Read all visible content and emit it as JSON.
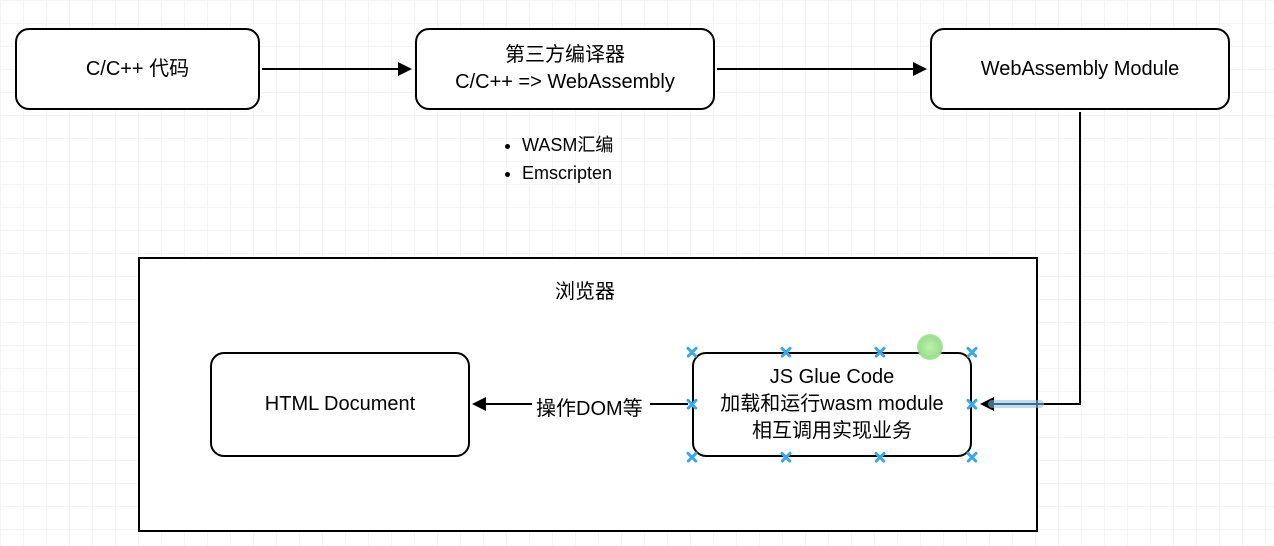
{
  "nodes": {
    "source": {
      "label": "C/C++ 代码"
    },
    "compiler": {
      "line1": "第三方编译器",
      "line2": "C/C++ => WebAssembly"
    },
    "wasm_module": {
      "label": "WebAssembly Module"
    },
    "html_doc": {
      "label": "HTML Document"
    },
    "glue": {
      "line1": "JS Glue Code",
      "line2": "加载和运行wasm module",
      "line3": "相互调用实现业务"
    }
  },
  "container": {
    "title": "浏览器"
  },
  "bullets": {
    "items": [
      "WASM汇编",
      "Emscripten"
    ]
  },
  "edges": {
    "dom_label": "操作DOM等"
  }
}
